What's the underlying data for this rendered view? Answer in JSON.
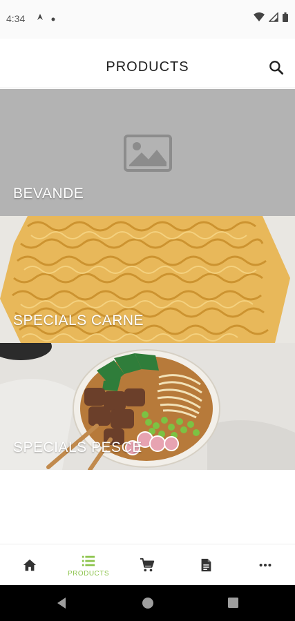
{
  "status_bar": {
    "time": "4:34",
    "icons_left": [
      "navigation-icon",
      "dot-icon"
    ],
    "icons_right": [
      "wifi-icon",
      "signal-icon",
      "battery-icon"
    ]
  },
  "app_bar": {
    "title": "PRODUCTS",
    "search_icon": "search-icon"
  },
  "categories": [
    {
      "label": "BEVANDE",
      "image": "image-placeholder-icon"
    },
    {
      "label": "SPECIALS CARNE",
      "image": "noodles-photo"
    },
    {
      "label": "SPECIALS PESCE",
      "image": "ramen-bowl-photo"
    }
  ],
  "bottom_nav": {
    "items": [
      {
        "icon": "home-icon",
        "label": ""
      },
      {
        "icon": "list-icon",
        "label": "PRODUCTS",
        "active": true
      },
      {
        "icon": "cart-icon",
        "label": ""
      },
      {
        "icon": "document-icon",
        "label": ""
      },
      {
        "icon": "more-icon",
        "label": ""
      }
    ],
    "active_color": "#8bc34a",
    "inactive_color": "#333333"
  },
  "android_nav": [
    "back-icon",
    "home-circle-icon",
    "recents-icon"
  ]
}
